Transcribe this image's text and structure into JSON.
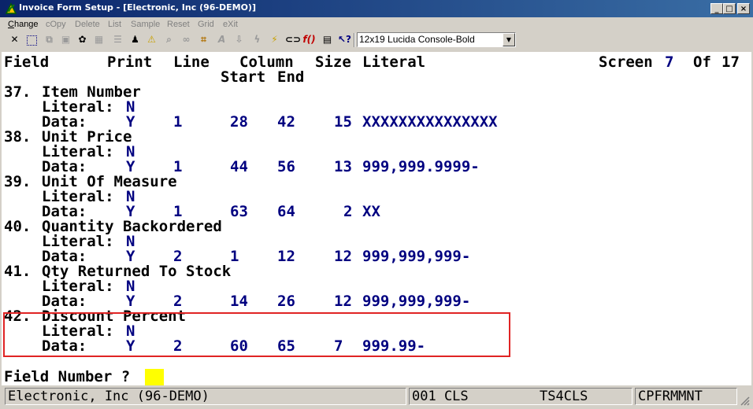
{
  "window": {
    "title": "Invoice Form Setup - [Electronic, Inc (96-DEMO)]",
    "minimize": "_",
    "maximize": "□",
    "close": "×"
  },
  "menu": [
    {
      "label": "Change",
      "accel": "C",
      "rest": "hange",
      "enabled": true
    },
    {
      "label": "cOpy",
      "enabled": false
    },
    {
      "label": "Delete",
      "enabled": false
    },
    {
      "label": "List",
      "enabled": false
    },
    {
      "label": "Sample",
      "enabled": false
    },
    {
      "label": "Reset",
      "enabled": false
    },
    {
      "label": "Grid",
      "enabled": false
    },
    {
      "label": "eXit",
      "enabled": false
    }
  ],
  "toolbar": {
    "font_select": "12x19 Lucida Console-Bold",
    "buttons": [
      "close-icon",
      "select-icon",
      "copy-icon",
      "paste-icon",
      "settings-icon",
      "properties-icon",
      "list-icon",
      "user-icon",
      "warning-icon",
      "find-icon",
      "binoculars-icon",
      "grid-icon",
      "font-icon",
      "import-icon",
      "lightning-icon",
      "export-icon",
      "link-icon",
      "function-icon",
      "notes-icon",
      "help-cursor-icon"
    ]
  },
  "screen": {
    "header": {
      "field": "Field",
      "print": "Print",
      "line": "Line",
      "column": "Column",
      "size": "Size",
      "literal": "Literal",
      "start": "Start",
      "end": "End",
      "screen_label": "Screen",
      "screen_num": "7",
      "of_label": "Of",
      "of_num": "17"
    },
    "literal_label": "Literal:",
    "data_label": "Data:",
    "fields": [
      {
        "num": "37.",
        "name": "Item Number",
        "literal": "N",
        "print": "Y",
        "line": "1",
        "start": "28",
        "end": "42",
        "size": "15",
        "mask": "XXXXXXXXXXXXXXX"
      },
      {
        "num": "38.",
        "name": "Unit Price",
        "literal": "N",
        "print": "Y",
        "line": "1",
        "start": "44",
        "end": "56",
        "size": "13",
        "mask": "999,999.9999-"
      },
      {
        "num": "39.",
        "name": "Unit Of Measure",
        "literal": "N",
        "print": "Y",
        "line": "1",
        "start": "63",
        "end": "64",
        "size": "2",
        "mask": "XX"
      },
      {
        "num": "40.",
        "name": "Quantity Backordered",
        "literal": "N",
        "print": "Y",
        "line": "2",
        "start": "1",
        "end": "12",
        "size": "12",
        "mask": "999,999,999-"
      },
      {
        "num": "41.",
        "name": "Qty Returned To Stock",
        "literal": "N",
        "print": "Y",
        "line": "2",
        "start": "14",
        "end": "26",
        "size": "12",
        "mask": "999,999,999-"
      },
      {
        "num": "42.",
        "name": "Discount Percent",
        "literal": "N",
        "print": "Y",
        "line": "2",
        "start": "60",
        "end": "65",
        "size": "7",
        "mask": "999.99-"
      }
    ],
    "prompt": "Field Number ?",
    "cursor": "_"
  },
  "status": {
    "company": "Electronic, Inc (96-DEMO)",
    "code": "001 CLS",
    "program": "TS4CLS",
    "module": "CPFRMMNT"
  }
}
